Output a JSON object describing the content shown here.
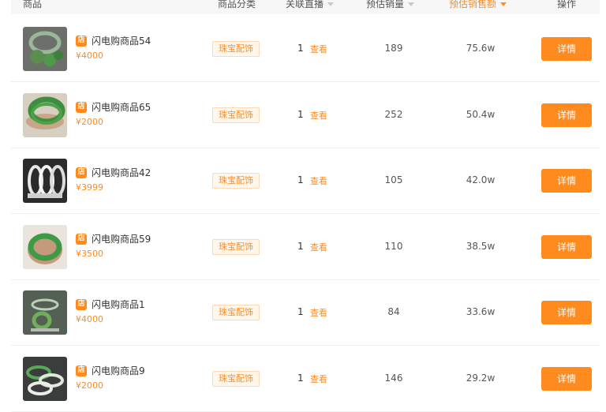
{
  "header": {
    "product": "商品",
    "category": "商品分类",
    "live": "关联直播",
    "sales": "预估销量",
    "gmv": "预估销售额",
    "action": "操作"
  },
  "rows": [
    {
      "name": "闪电购商品54",
      "price": "¥4000",
      "category": "珠宝配饰",
      "live_count": "1",
      "live_link": "查看",
      "sales": "189",
      "gmv": "75.6w",
      "action": "详情"
    },
    {
      "name": "闪电购商品65",
      "price": "¥2000",
      "category": "珠宝配饰",
      "live_count": "1",
      "live_link": "查看",
      "sales": "252",
      "gmv": "50.4w",
      "action": "详情"
    },
    {
      "name": "闪电购商品42",
      "price": "¥3999",
      "category": "珠宝配饰",
      "live_count": "1",
      "live_link": "查看",
      "sales": "105",
      "gmv": "42.0w",
      "action": "详情"
    },
    {
      "name": "闪电购商品59",
      "price": "¥3500",
      "category": "珠宝配饰",
      "live_count": "1",
      "live_link": "查看",
      "sales": "110",
      "gmv": "38.5w",
      "action": "详情"
    },
    {
      "name": "闪电购商品1",
      "price": "¥4000",
      "category": "珠宝配饰",
      "live_count": "1",
      "live_link": "查看",
      "sales": "84",
      "gmv": "33.6w",
      "action": "详情"
    },
    {
      "name": "闪电购商品9",
      "price": "¥2000",
      "category": "珠宝配饰",
      "live_count": "1",
      "live_link": "查看",
      "sales": "146",
      "gmv": "29.2w",
      "action": "详情"
    }
  ],
  "colors": {
    "accent": "#ff8b1f",
    "jade": "#4e9a4a",
    "tag_bg": "#fff6ec"
  },
  "icons": {
    "store": "shop-badge-icon"
  }
}
